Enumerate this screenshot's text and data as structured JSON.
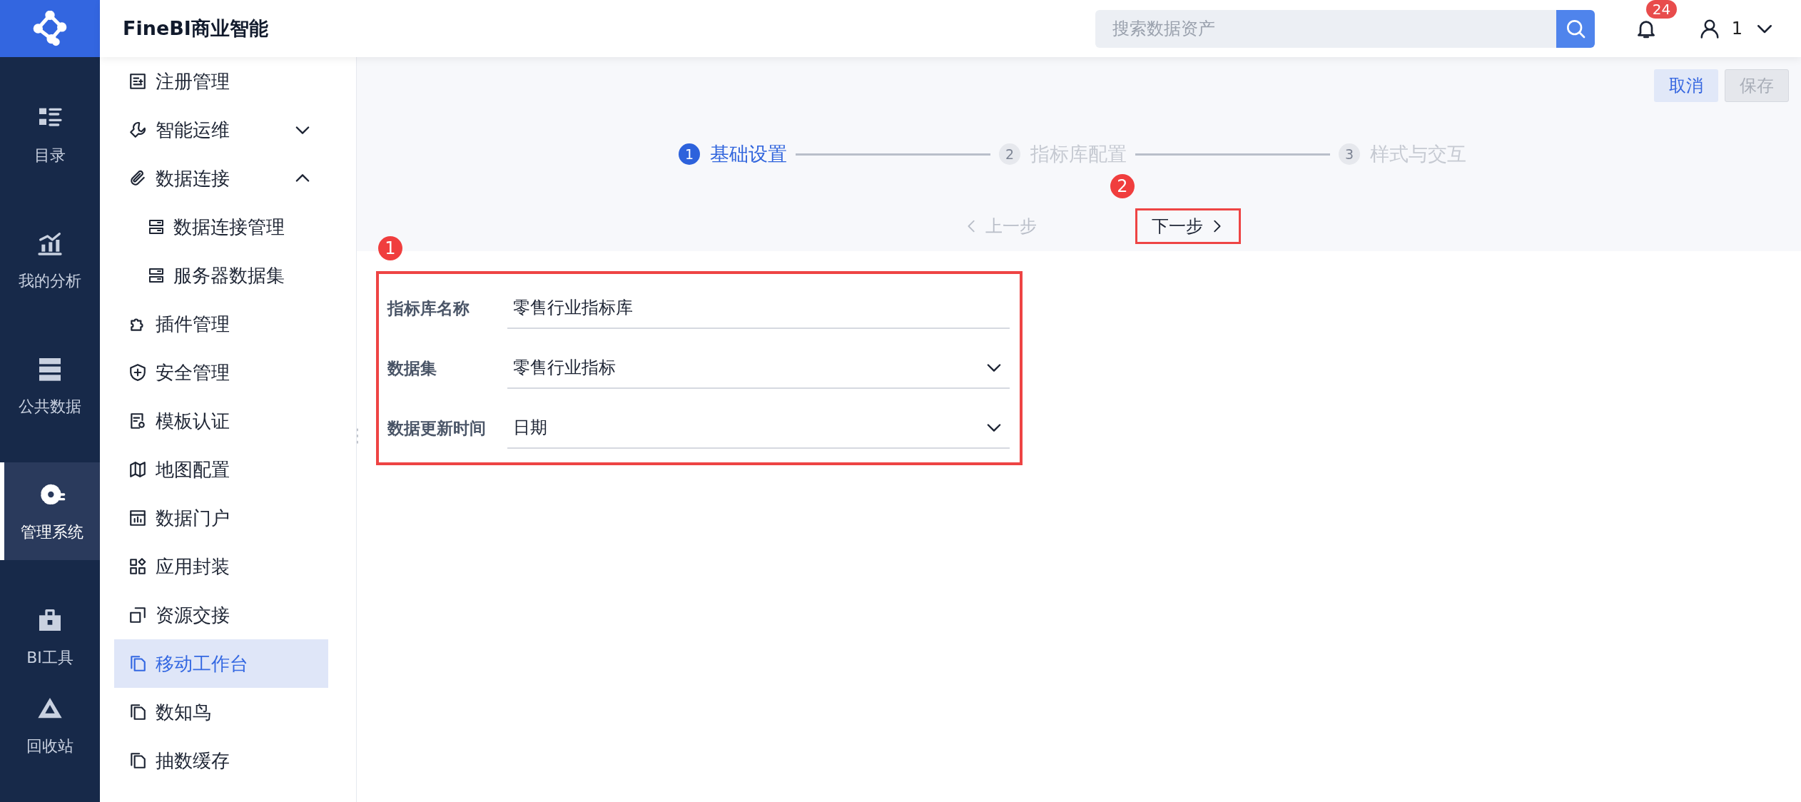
{
  "rail": {
    "items": [
      {
        "label": "目录",
        "selected": false
      },
      {
        "label": "我的分析",
        "selected": false
      },
      {
        "label": "公共数据",
        "selected": false
      },
      {
        "label": "管理系统",
        "selected": true
      },
      {
        "label": "BI工具",
        "selected": false
      },
      {
        "label": "回收站",
        "selected": false
      }
    ]
  },
  "header": {
    "title": "FineBI商业智能",
    "search": {
      "placeholder": "搜索数据资产"
    },
    "notifications": "24",
    "user": "1"
  },
  "sidebar": {
    "items": [
      {
        "label": "注册管理",
        "selected": false
      },
      {
        "label": "智能运维",
        "selected": false,
        "expanded": false
      },
      {
        "label": "数据连接",
        "selected": false,
        "expanded": true,
        "children": [
          {
            "label": "数据连接管理",
            "selected": false
          },
          {
            "label": "服务器数据集",
            "selected": false
          }
        ]
      },
      {
        "label": "插件管理",
        "selected": false
      },
      {
        "label": "安全管理",
        "selected": false
      },
      {
        "label": "模板认证",
        "selected": false
      },
      {
        "label": "地图配置",
        "selected": false
      },
      {
        "label": "数据门户",
        "selected": false
      },
      {
        "label": "应用封装",
        "selected": false
      },
      {
        "label": "资源交接",
        "selected": false
      },
      {
        "label": "移动工作台",
        "selected": true
      },
      {
        "label": "数知鸟",
        "selected": false
      },
      {
        "label": "抽数缓存",
        "selected": false
      }
    ]
  },
  "actions": [
    {
      "label": "取消",
      "disabled": false
    },
    {
      "label": "保存",
      "disabled": true
    }
  ],
  "steps": [
    {
      "number": "1",
      "label": "基础设置",
      "selected": true
    },
    {
      "number": "2",
      "label": "指标库配置",
      "selected": false
    },
    {
      "number": "3",
      "label": "样式与交互",
      "selected": false
    }
  ],
  "navigation": {
    "previous": {
      "label": "上一步",
      "disabled": true
    },
    "next": {
      "label": "下一步",
      "disabled": false
    }
  },
  "form": {
    "fields": [
      {
        "kind": "text",
        "label": "指标库名称",
        "value": "零售行业指标库"
      },
      {
        "kind": "select",
        "label": "数据集",
        "value": "零售行业指标"
      },
      {
        "kind": "select",
        "label": "数据更新时间",
        "value": "日期"
      }
    ]
  },
  "annotations": [
    {
      "number": "1"
    },
    {
      "number": "2"
    }
  ]
}
